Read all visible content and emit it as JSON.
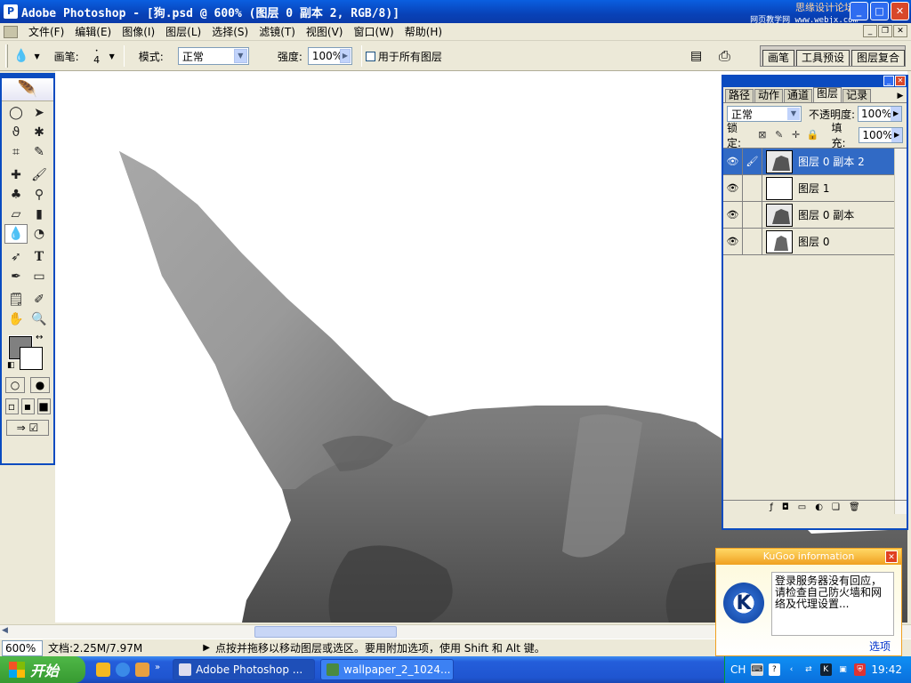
{
  "titlebar": {
    "title": "Adobe Photoshop - [狗.psd @ 600% (图层 0 副本 2, RGB/8)]",
    "watermark": "思缘设计论坛",
    "watermark_url": "网页教学网 www.webjx.com"
  },
  "menu": [
    "文件(F)",
    "编辑(E)",
    "图像(I)",
    "图层(L)",
    "选择(S)",
    "滤镜(T)",
    "视图(V)",
    "窗口(W)",
    "帮助(H)"
  ],
  "options": {
    "brush_label": "画笔:",
    "brush_size": "4",
    "mode_label": "模式:",
    "mode_value": "正常",
    "strength_label": "强度:",
    "strength_value": "100%",
    "all_layers_label": "用于所有图层",
    "palette_tabs": [
      "画笔",
      "工具预设",
      "图层复合"
    ]
  },
  "layers_panel": {
    "tabs": [
      "路径",
      "动作",
      "通道",
      "图层",
      "记录"
    ],
    "active_tab": "图层",
    "blend_mode": "正常",
    "opacity_label": "不透明度:",
    "opacity_value": "100%",
    "lock_label": "锁定:",
    "fill_label": "填充:",
    "fill_value": "100%",
    "layers": [
      {
        "name": "图层 0 副本 2",
        "selected": true
      },
      {
        "name": "图层 1",
        "selected": false
      },
      {
        "name": "图层 0 副本",
        "selected": false
      },
      {
        "name": "图层 0",
        "selected": false
      }
    ]
  },
  "status": {
    "zoom": "600%",
    "doc_info": "文档:2.25M/7.97M",
    "hint": "点按并拖移以移动图层或选区。要用附加选项，使用 Shift 和 Alt 键。"
  },
  "kugoo": {
    "title": "KuGoo information",
    "message": "登录服务器没有回应，请检查自己防火墙和网络及代理设置...",
    "link": "选项"
  },
  "taskbar": {
    "start": "开始",
    "tasks": [
      "Adobe Photoshop ...",
      "wallpaper_2_1024..."
    ],
    "lang": "CH",
    "clock": "19:42"
  }
}
